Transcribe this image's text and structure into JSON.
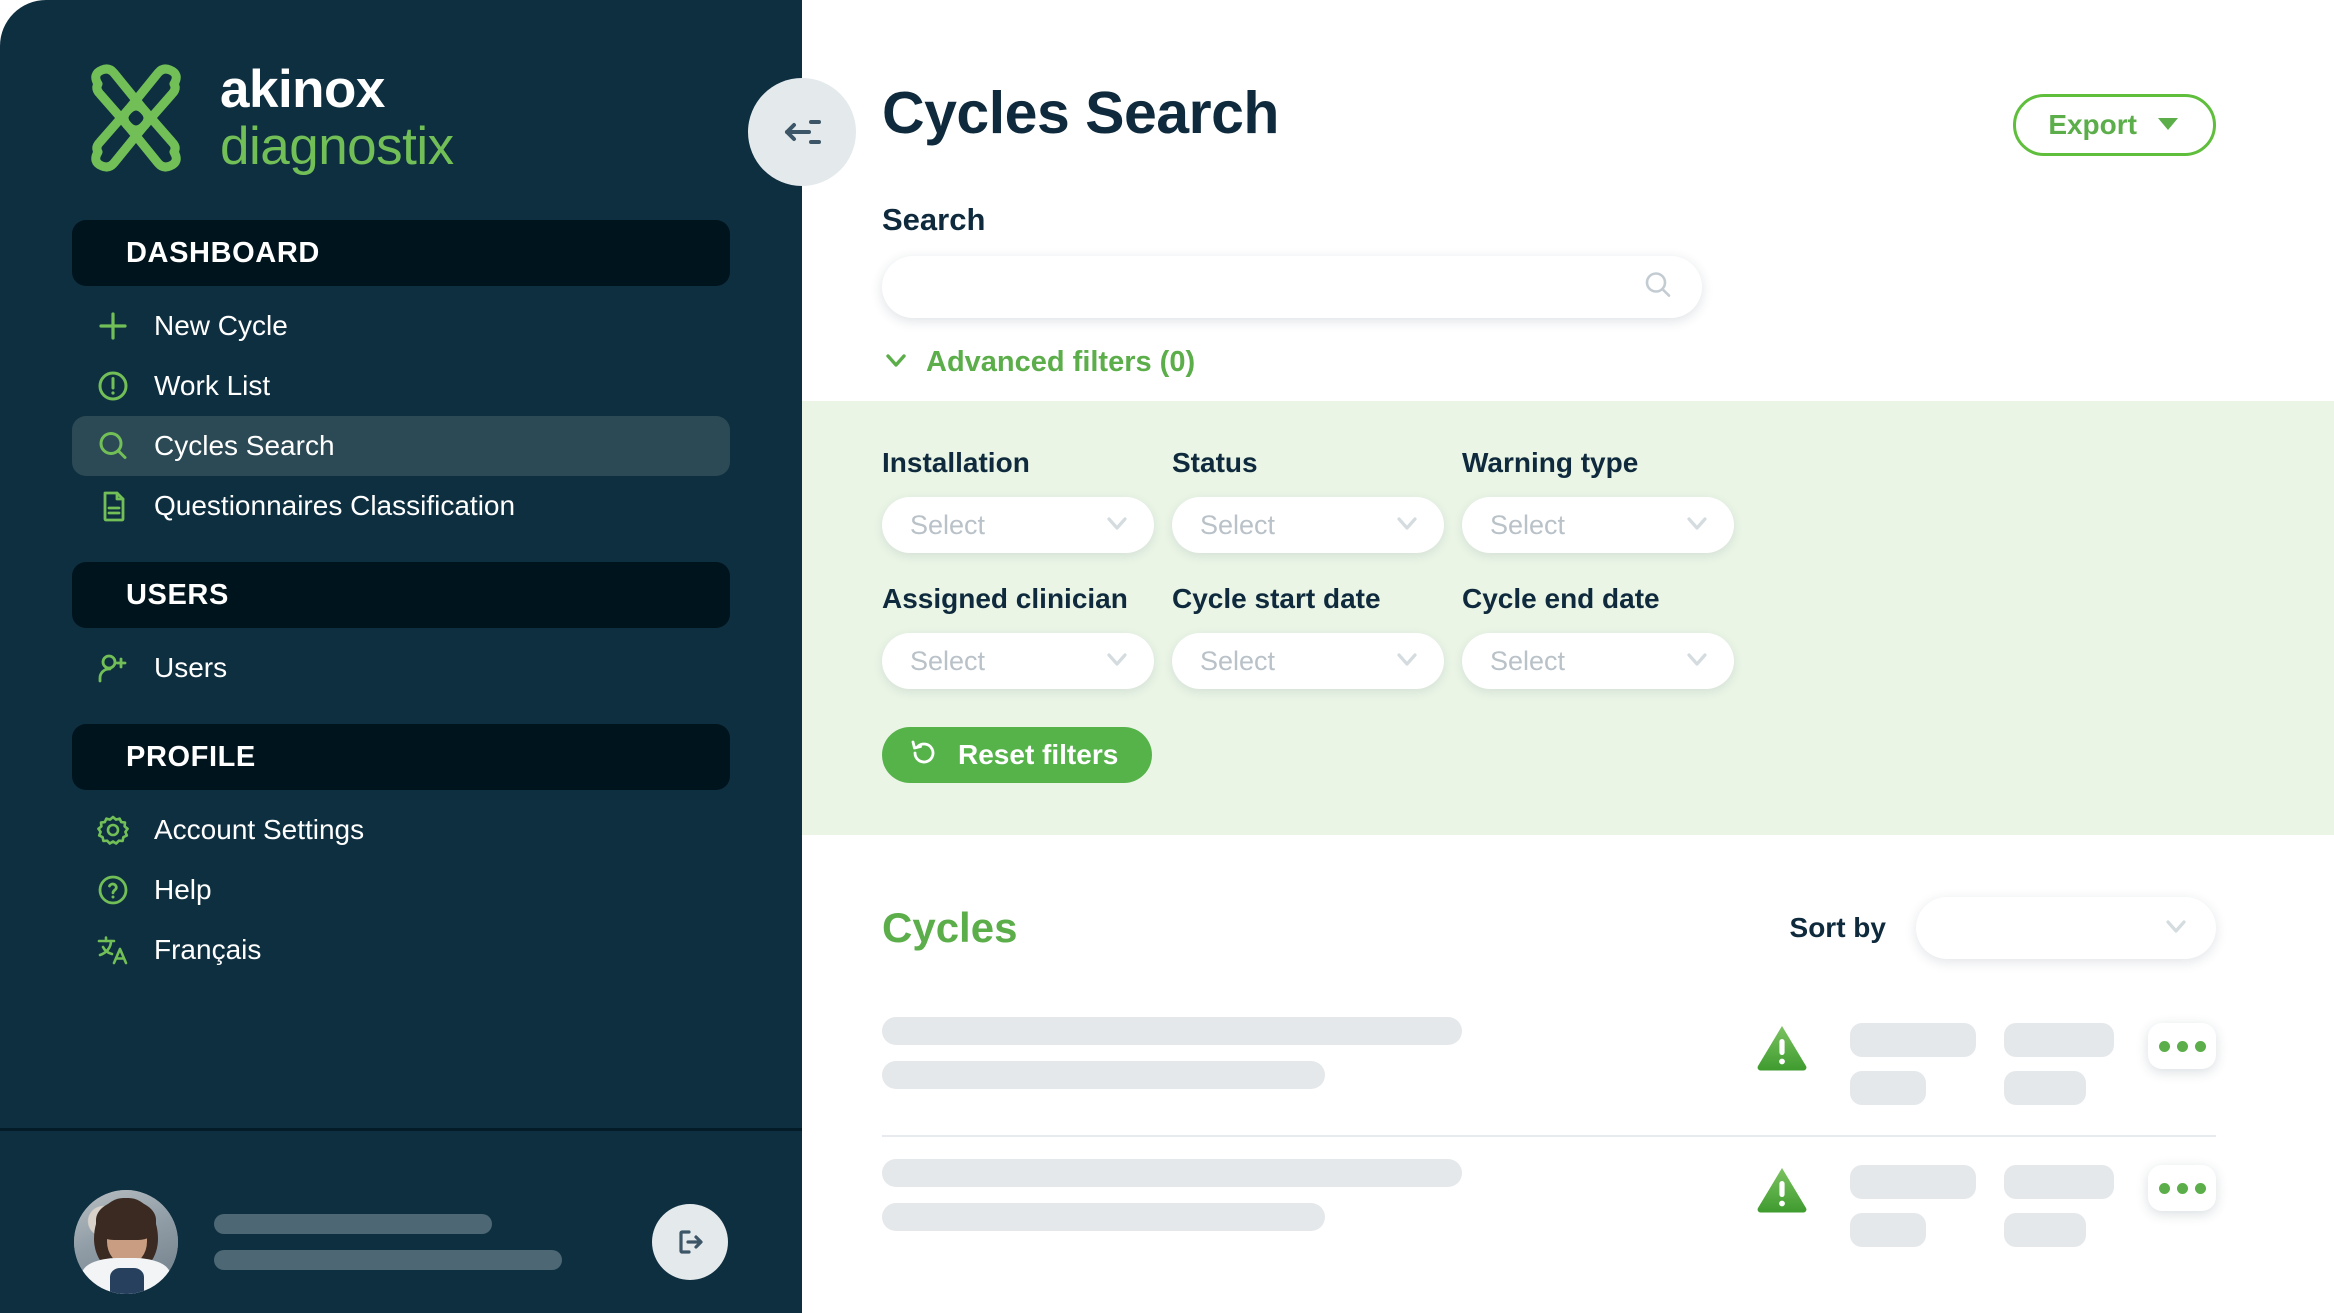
{
  "brand": {
    "name_primary": "akinox",
    "name_secondary": "diagnostix",
    "logo_icon": "akinox-pinwheel-logo",
    "color_green": "#72BF57",
    "color_dark": "#0E2F40"
  },
  "sidebar": {
    "collapse_icon": "collapse-sidebar-icon",
    "sections": [
      {
        "title": "DASHBOARD",
        "items": [
          {
            "label": "New Cycle",
            "icon": "plus-icon",
            "active": false
          },
          {
            "label": "Work List",
            "icon": "alert-circle-icon",
            "active": false
          },
          {
            "label": "Cycles Search",
            "icon": "search-icon",
            "active": true
          },
          {
            "label": "Questionnaires Classification",
            "icon": "document-icon",
            "active": false
          }
        ]
      },
      {
        "title": "USERS",
        "items": [
          {
            "label": "Users",
            "icon": "user-add-icon",
            "active": false
          }
        ]
      },
      {
        "title": "PROFILE",
        "items": [
          {
            "label": "Account Settings",
            "icon": "gear-icon",
            "active": false
          },
          {
            "label": "Help",
            "icon": "question-circle-icon",
            "active": false
          },
          {
            "label": "Français",
            "icon": "translate-icon",
            "active": false
          }
        ]
      }
    ],
    "footer": {
      "avatar_icon": "user-avatar-photo",
      "name_placeholder_loading": true,
      "logout_icon": "logout-icon"
    }
  },
  "header": {
    "title": "Cycles Search",
    "export": {
      "label": "Export",
      "icon": "caret-down-icon"
    }
  },
  "search": {
    "label": "Search",
    "value": "",
    "placeholder": "",
    "icon": "search-icon"
  },
  "advanced_filters": {
    "label": "Advanced filters (0)",
    "count": 0,
    "expanded": true,
    "icon": "chevron-down-icon",
    "fields": [
      {
        "label": "Installation",
        "value": "Select",
        "icon": "chevron-down-icon"
      },
      {
        "label": "Status",
        "value": "Select",
        "icon": "chevron-down-icon"
      },
      {
        "label": "Warning type",
        "value": "Select",
        "icon": "chevron-down-icon"
      },
      {
        "label": "Assigned clinician",
        "value": "Select",
        "icon": "chevron-down-icon"
      },
      {
        "label": "Cycle start date",
        "value": "Select",
        "icon": "chevron-down-icon"
      },
      {
        "label": "Cycle end date",
        "value": "Select",
        "icon": "chevron-down-icon"
      }
    ],
    "reset": {
      "label": "Reset filters",
      "icon": "reset-arrow-icon"
    },
    "panel_color": "#EAF5E6"
  },
  "cycles": {
    "title": "Cycles",
    "sort": {
      "label": "Sort by",
      "value": "",
      "icon": "chevron-down-icon"
    },
    "loading": true,
    "rows": [
      {
        "warning_icon": "warning-triangle-icon",
        "menu_icon": "more-options-icon"
      },
      {
        "warning_icon": "warning-triangle-icon",
        "menu_icon": "more-options-icon"
      }
    ]
  },
  "colors": {
    "accent_green": "#5BAE4A",
    "bright_green": "#72BF57",
    "dark_navy": "#0E2A3C",
    "sidebar_bg": "#0E2F40",
    "section_header_bg": "#00141D",
    "active_item_bg": "#2C4A55",
    "skeleton_gray": "#E4E8EA"
  }
}
